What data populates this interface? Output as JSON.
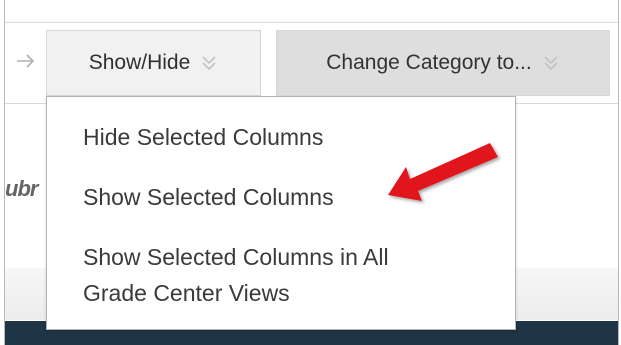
{
  "toolbar": {
    "back_icon": "arrow-right-icon",
    "show_hide_label": "Show/Hide",
    "change_category_label": "Change Category to...",
    "chevron_icon": "double-chevron-down-icon"
  },
  "background": {
    "clipped_text": "ubr"
  },
  "dropdown": {
    "items": [
      {
        "label": "Hide Selected Columns"
      },
      {
        "label": "Show Selected Columns"
      },
      {
        "label_line1": "Show Selected Columns in All",
        "label_line2": "Grade Center Views"
      }
    ]
  },
  "annotation": {
    "icon": "red-pointer-arrow-icon",
    "color": "#e0191c"
  },
  "colors": {
    "bottom_bar": "#1f3546",
    "button_bg": "#ebebeb",
    "text": "#3a3a3a"
  }
}
